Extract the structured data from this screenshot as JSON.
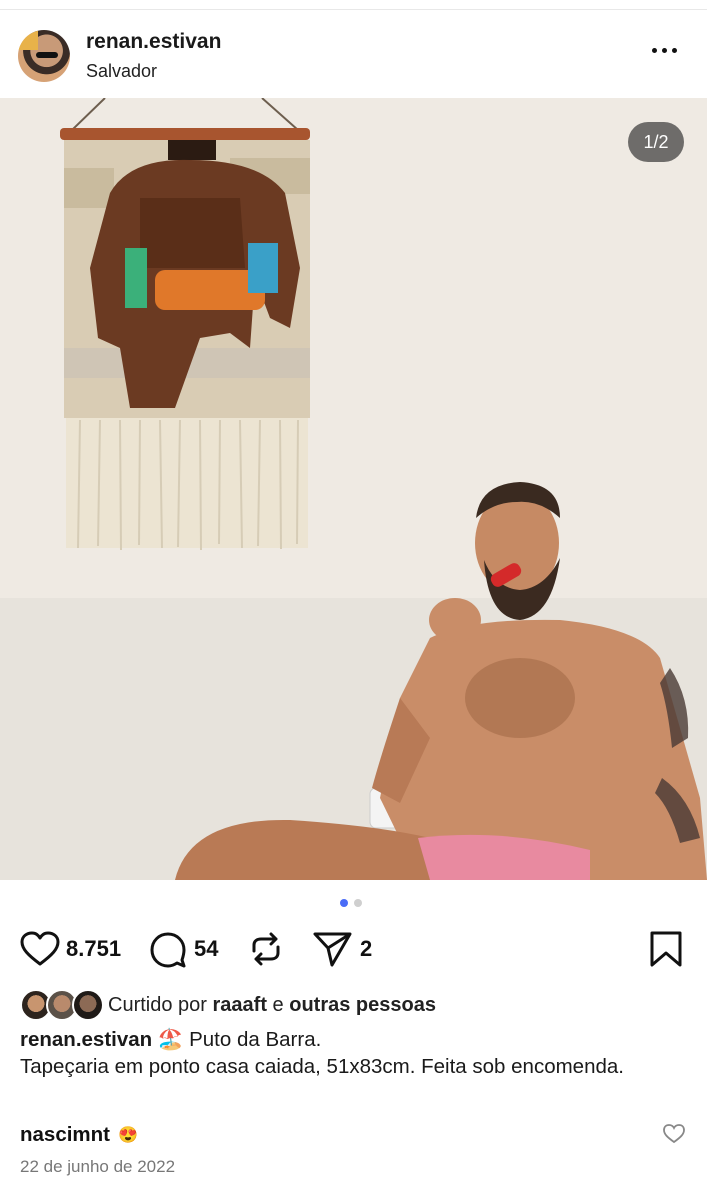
{
  "post": {
    "username": "renan.estivan",
    "location": "Salvador",
    "image_counter": "1/2",
    "carousel": {
      "total": 2,
      "active": 1
    }
  },
  "actions": {
    "likes": "8.751",
    "comments": "54",
    "shares": "2"
  },
  "liked_by": {
    "prefix": "Curtido por ",
    "user": "raaaft",
    "middle": " e ",
    "others": "outras pessoas"
  },
  "caption": {
    "username": "renan.estivan",
    "emoji": "🏖️",
    "text_line1": "Puto da Barra.",
    "text_line2": "Tapeçaria em ponto casa caiada, 51x83cm. Feita sob encomenda."
  },
  "comment": {
    "username": "nascimnt",
    "emoji": "😍"
  },
  "date": "22 de junho de 2022",
  "colors": {
    "accent_dot": "#4a6cf7",
    "text": "#111111",
    "muted": "#777777"
  }
}
